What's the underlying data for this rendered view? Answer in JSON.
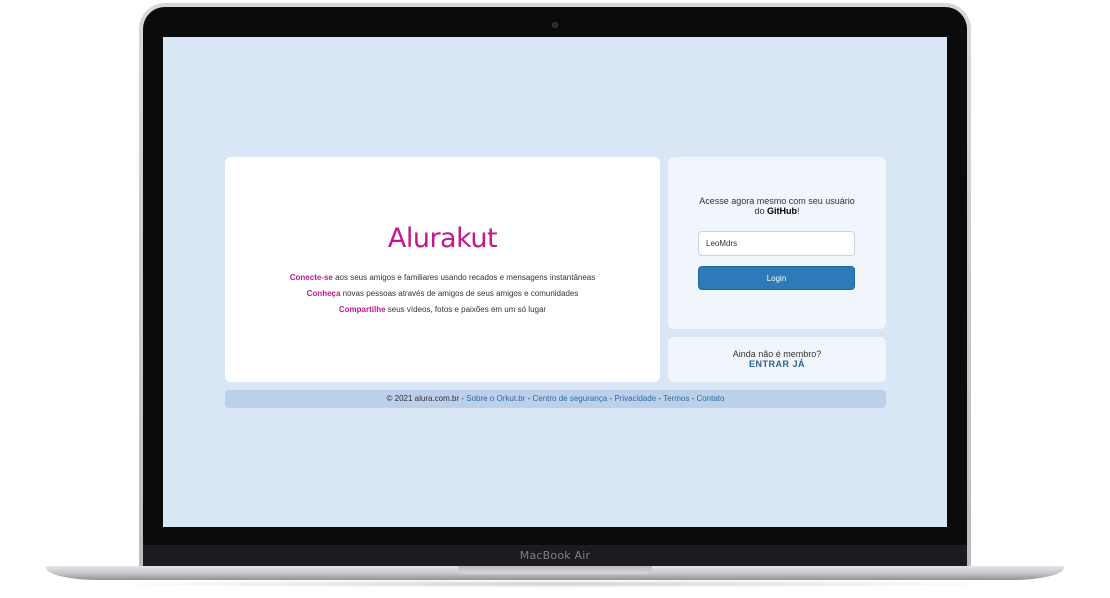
{
  "device": {
    "label": "MacBook Air"
  },
  "welcome": {
    "logo": "Alurakut",
    "features": [
      {
        "bold": "Conecte-se",
        "text": " aos seus amigos e familiares usando recados e mensagens instantâneas"
      },
      {
        "bold": "Conheça",
        "text": " novas pessoas através de amigos de seus amigos e comunidades"
      },
      {
        "bold": "Compartilhe",
        "text": " seus vídeos, fotos e paixões em um só lugar"
      }
    ]
  },
  "login": {
    "prompt": "Acesse agora mesmo com seu usuário",
    "prompt_prefix2": "do ",
    "prompt_bold": "GitHub",
    "prompt_suffix": "!",
    "username_value": "LeoMdrs",
    "button_label": "Login"
  },
  "signup": {
    "question": "Ainda não é membro?",
    "link": "ENTRAR JÁ"
  },
  "footer": {
    "copyright": "© 2021 alura.com.br",
    "sep": " - ",
    "links": [
      "Sobre o Orkut.br",
      "Centro de segurança",
      "Privacidade",
      "Termos",
      "Contato"
    ]
  },
  "colors": {
    "brand": "#c2188b",
    "primary_button": "#2e79b7",
    "screen_bg": "#d9e6f6",
    "footer_bg": "#bcd0ea"
  }
}
